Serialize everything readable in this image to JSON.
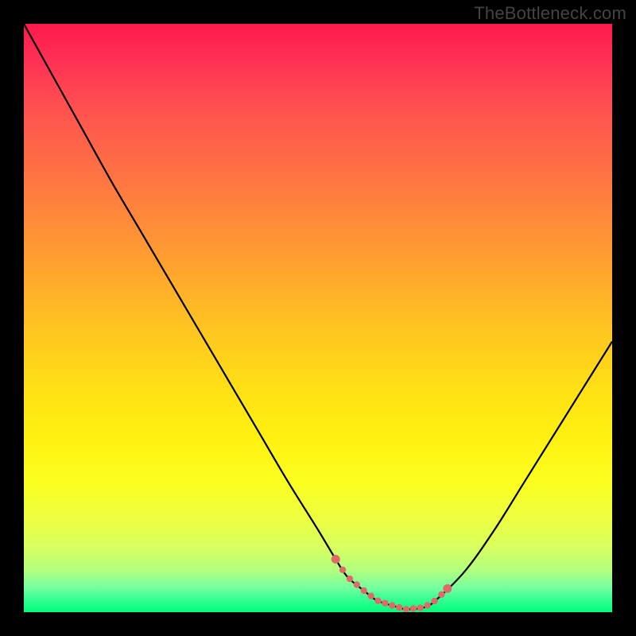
{
  "watermark": "TheBottleneck.com",
  "chart_data": {
    "type": "line",
    "title": "",
    "xlabel": "",
    "ylabel": "",
    "xlim": [
      0,
      100
    ],
    "ylim": [
      0,
      100
    ],
    "grid": false,
    "legend": false,
    "series": [
      {
        "name": "bottleneck-curve",
        "x": [
          0,
          5,
          10,
          15,
          20,
          25,
          30,
          35,
          40,
          45,
          50,
          53,
          55,
          58,
          60,
          63,
          65,
          68,
          70,
          75,
          80,
          85,
          90,
          95,
          100
        ],
        "values": [
          100,
          91,
          82,
          73,
          64.5,
          56,
          47.5,
          39,
          30.5,
          22,
          14,
          9,
          6,
          3.5,
          2,
          1,
          0.5,
          0.8,
          2,
          7,
          14,
          22,
          30,
          38,
          46
        ]
      }
    ],
    "highlight_region": {
      "name": "optimal-zone-dots",
      "x_start": 53,
      "x_end": 72,
      "color": "#e06a6a"
    },
    "background_gradient": {
      "direction": "vertical",
      "stops": [
        {
          "pos": 0,
          "color": "#ff1a4d"
        },
        {
          "pos": 50,
          "color": "#ffd020"
        },
        {
          "pos": 80,
          "color": "#f5ff30"
        },
        {
          "pos": 100,
          "color": "#00ff7a"
        }
      ]
    }
  }
}
